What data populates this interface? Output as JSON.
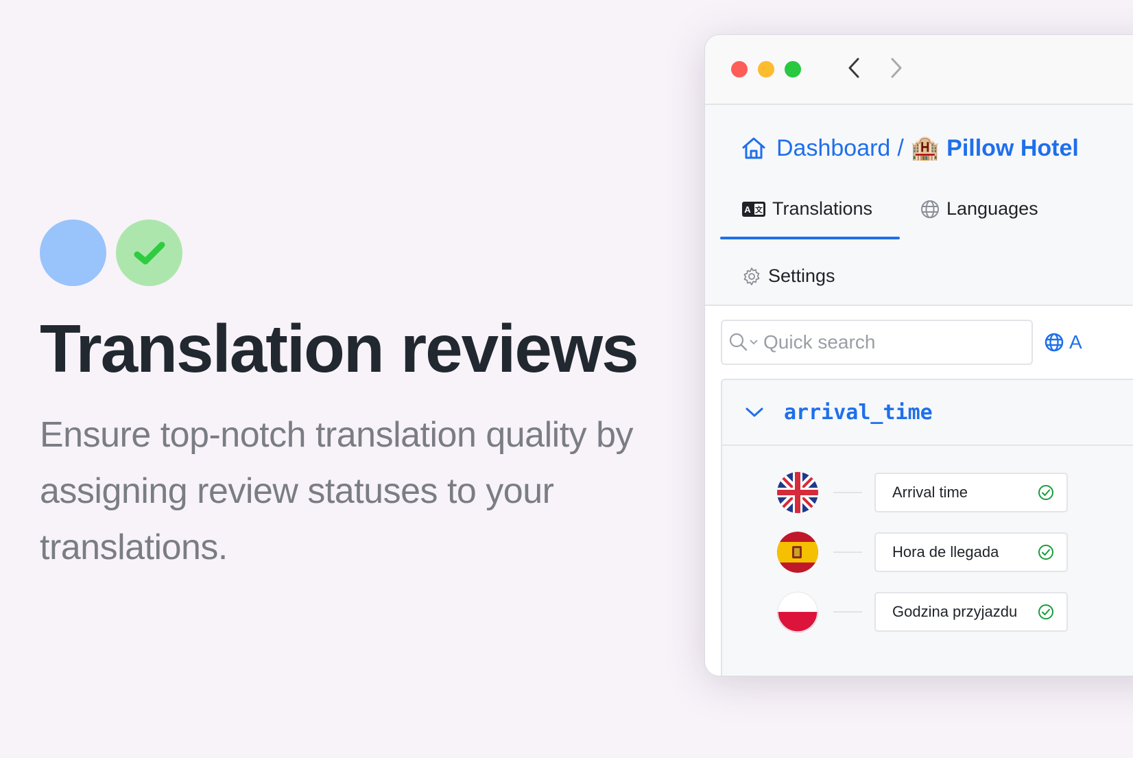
{
  "hero": {
    "title": "Translation reviews",
    "description": "Ensure top-notch translation quality by assigning review statuses to your translations.",
    "icons": [
      "blue-circle-icon",
      "green-check-circle-icon"
    ],
    "colors": {
      "blue_circle": "#99c3fb",
      "green_circle": "#ade6ad",
      "check": "#2ecc40"
    }
  },
  "window": {
    "nav": {
      "back_icon": "chevron-left-icon",
      "forward_icon": "chevron-right-icon"
    },
    "breadcrumb": {
      "home_label": "Dashboard",
      "separator": "/",
      "project_emoji": "🏨",
      "project_label": "Pillow Hotel"
    },
    "tabs": [
      {
        "label": "Translations",
        "icon": "translate-icon",
        "active": true
      },
      {
        "label": "Languages",
        "icon": "globe-icon",
        "active": false
      },
      {
        "label": "Settings",
        "icon": "gear-icon",
        "active": false
      }
    ],
    "search": {
      "placeholder": "Quick search",
      "value": ""
    },
    "language_button_label": "A",
    "key": {
      "name": "arrival_time",
      "translations": [
        {
          "language": "English",
          "flag": "gb",
          "text": "Arrival time",
          "status": "reviewed"
        },
        {
          "language": "Spanish",
          "flag": "es",
          "text": "Hora de llegada",
          "status": "reviewed"
        },
        {
          "language": "Polish",
          "flag": "pl",
          "text": "Godzina przyjazdu",
          "status": "reviewed"
        }
      ]
    },
    "colors": {
      "accent": "#1f6feb",
      "reviewed": "#1a9c3e"
    }
  }
}
